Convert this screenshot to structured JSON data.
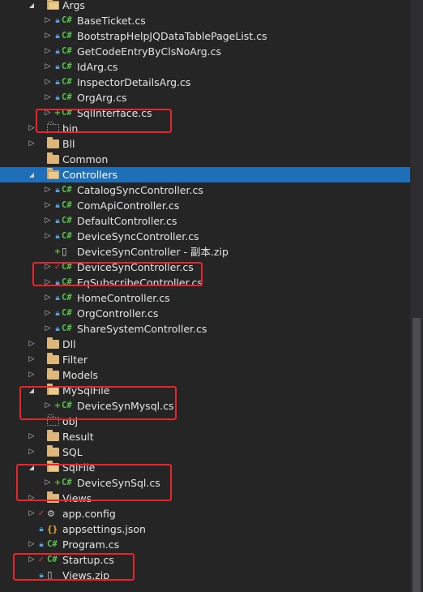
{
  "tree": {
    "rows": [
      {
        "label": "Args",
        "kind": "folder-open",
        "arrow": "open",
        "status": "",
        "indent": 2
      },
      {
        "label": "BaseTicket.cs",
        "kind": "cs",
        "arrow": "closed",
        "status": "lock",
        "indent": 3
      },
      {
        "label": "BootstrapHelpJQDataTablePageList.cs",
        "kind": "cs",
        "arrow": "closed",
        "status": "lock",
        "indent": 3
      },
      {
        "label": "GetCodeEntryByClsNoArg.cs",
        "kind": "cs",
        "arrow": "closed",
        "status": "lock",
        "indent": 3
      },
      {
        "label": "IdArg.cs",
        "kind": "cs",
        "arrow": "closed",
        "status": "lock",
        "indent": 3
      },
      {
        "label": "InspectorDetailsArg.cs",
        "kind": "cs",
        "arrow": "closed",
        "status": "lock",
        "indent": 3
      },
      {
        "label": "OrgArg.cs",
        "kind": "cs",
        "arrow": "closed",
        "status": "lock",
        "indent": 3
      },
      {
        "label": "SqlInterface.cs",
        "kind": "cs",
        "arrow": "closed",
        "status": "plus",
        "indent": 3
      },
      {
        "label": "bin",
        "kind": "folder-dotted",
        "arrow": "closed",
        "status": "",
        "indent": 2
      },
      {
        "label": "Bll",
        "kind": "folder",
        "arrow": "closed",
        "status": "",
        "indent": 2
      },
      {
        "label": "Common",
        "kind": "folder",
        "arrow": "none",
        "status": "",
        "indent": 2
      },
      {
        "label": "Controllers",
        "kind": "folder-open",
        "arrow": "open",
        "status": "",
        "indent": 2,
        "selected": true
      },
      {
        "label": "CatalogSyncController.cs",
        "kind": "cs",
        "arrow": "closed",
        "status": "lock",
        "indent": 3
      },
      {
        "label": "ComApiController.cs",
        "kind": "cs",
        "arrow": "closed",
        "status": "lock",
        "indent": 3
      },
      {
        "label": "DefaultController.cs",
        "kind": "cs",
        "arrow": "closed",
        "status": "lock",
        "indent": 3
      },
      {
        "label": "DeviceSyncController.cs",
        "kind": "cs",
        "arrow": "closed",
        "status": "lock",
        "indent": 3
      },
      {
        "label": "DeviceSynController - 副本.zip",
        "kind": "file",
        "arrow": "none",
        "status": "plus",
        "indent": 3
      },
      {
        "label": "DeviceSynController.cs",
        "kind": "cs",
        "arrow": "closed",
        "status": "check",
        "indent": 3
      },
      {
        "label": "EqSubscribeController.cs",
        "kind": "cs",
        "arrow": "closed",
        "status": "lock",
        "indent": 3
      },
      {
        "label": "HomeController.cs",
        "kind": "cs",
        "arrow": "closed",
        "status": "lock",
        "indent": 3
      },
      {
        "label": "OrgController.cs",
        "kind": "cs",
        "arrow": "closed",
        "status": "lock",
        "indent": 3
      },
      {
        "label": "ShareSystemController.cs",
        "kind": "cs",
        "arrow": "closed",
        "status": "lock",
        "indent": 3
      },
      {
        "label": "Dll",
        "kind": "folder",
        "arrow": "closed",
        "status": "",
        "indent": 2
      },
      {
        "label": "Filter",
        "kind": "folder",
        "arrow": "closed",
        "status": "",
        "indent": 2
      },
      {
        "label": "Models",
        "kind": "folder",
        "arrow": "closed",
        "status": "",
        "indent": 2
      },
      {
        "label": "MySqlFile",
        "kind": "folder-open",
        "arrow": "open",
        "status": "",
        "indent": 2
      },
      {
        "label": "DeviceSynMysql.cs",
        "kind": "cs",
        "arrow": "closed",
        "status": "plus",
        "indent": 3
      },
      {
        "label": "obj",
        "kind": "folder-dotted",
        "arrow": "none",
        "status": "",
        "indent": 2
      },
      {
        "label": "Result",
        "kind": "folder",
        "arrow": "closed",
        "status": "",
        "indent": 2
      },
      {
        "label": "SQL",
        "kind": "folder",
        "arrow": "closed",
        "status": "",
        "indent": 2
      },
      {
        "label": "SqlFile",
        "kind": "folder-open",
        "arrow": "open",
        "status": "",
        "indent": 2
      },
      {
        "label": "DeviceSynSql.cs",
        "kind": "cs",
        "arrow": "closed",
        "status": "plus",
        "indent": 3
      },
      {
        "label": "Views",
        "kind": "folder",
        "arrow": "closed",
        "status": "",
        "indent": 2
      },
      {
        "label": "app.config",
        "kind": "config",
        "arrow": "closed",
        "status": "check",
        "indent": 2
      },
      {
        "label": "appsettings.json",
        "kind": "json",
        "arrow": "none",
        "status": "lock",
        "indent": 2
      },
      {
        "label": "Program.cs",
        "kind": "cs",
        "arrow": "closed",
        "status": "lock",
        "indent": 2
      },
      {
        "label": "Startup.cs",
        "kind": "cs",
        "arrow": "closed",
        "status": "check",
        "indent": 2
      },
      {
        "label": "Views.zip",
        "kind": "file",
        "arrow": "none",
        "status": "lock",
        "indent": 2
      }
    ],
    "icons": {
      "cs": "C#",
      "json": "{}",
      "config": "⚙",
      "file": "▯",
      "arrow_open": "◢",
      "arrow_closed": "▷",
      "lock": "🔒︎",
      "plus": "+",
      "check": "✓"
    }
  },
  "colors": {
    "background": "#252526",
    "selection": "#1e6fb7",
    "folder": "#dcb67a",
    "cs_icon": "#58c24f",
    "annotation": "#e8252d"
  }
}
